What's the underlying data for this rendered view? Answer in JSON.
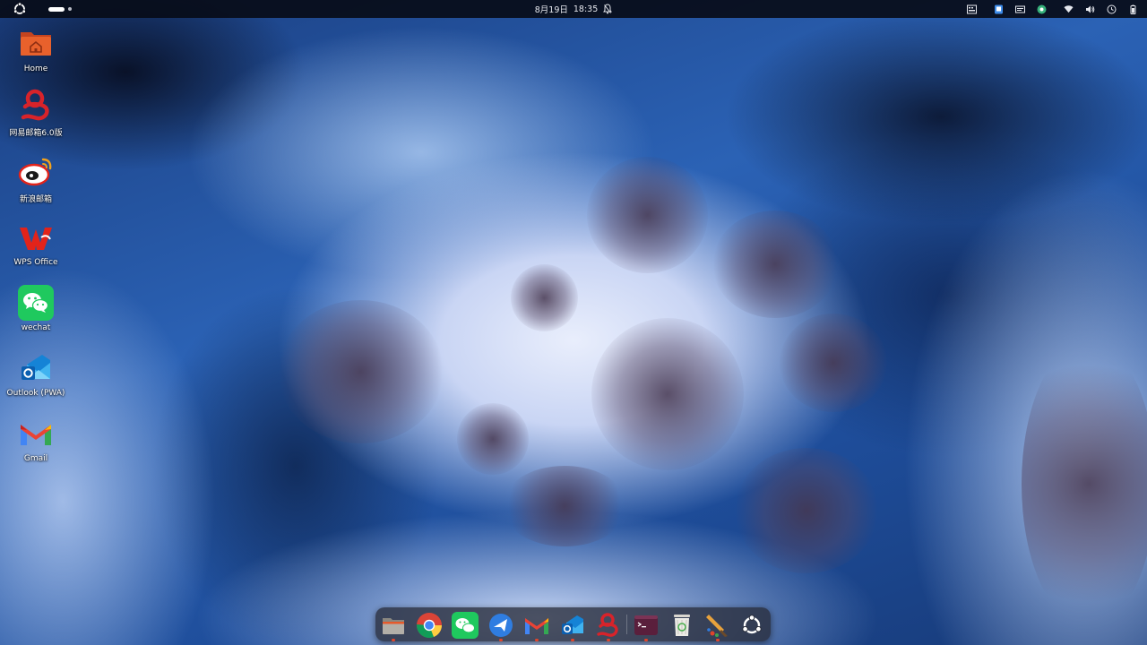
{
  "topbar": {
    "date": "8月19日",
    "time": "18:35",
    "icons": [
      "ubuntu-logo-icon",
      "workspace-indicator",
      "bell-icon",
      "keyboard-layout-icon",
      "app-indicator-icon",
      "input-method-icon",
      "tray-app-icon",
      "wifi-icon",
      "volume-icon",
      "clock-icon",
      "battery-icon"
    ]
  },
  "desktop": {
    "icons": [
      {
        "label": "Home",
        "icon": "home-folder-icon"
      },
      {
        "label": "网易邮箱6.0版",
        "icon": "netease-mail-icon"
      },
      {
        "label": "新浪邮箱",
        "icon": "sina-mail-icon"
      },
      {
        "label": "WPS Office",
        "icon": "wps-office-icon"
      },
      {
        "label": "wechat",
        "icon": "wechat-icon"
      },
      {
        "label": "Outlook (PWA)",
        "icon": "outlook-icon"
      },
      {
        "label": "Gmail",
        "icon": "gmail-icon"
      }
    ]
  },
  "dock": {
    "items": [
      {
        "icon": "files-icon",
        "running": true
      },
      {
        "icon": "chrome-icon",
        "running": false
      },
      {
        "icon": "wechat-icon",
        "running": false
      },
      {
        "icon": "feishu-icon",
        "running": true
      },
      {
        "icon": "gmail-icon",
        "running": true
      },
      {
        "icon": "outlook-icon",
        "running": true
      },
      {
        "icon": "netease-mail-icon",
        "running": true
      },
      {
        "icon": "terminal-icon",
        "running": true
      },
      {
        "icon": "trash-icon",
        "running": false
      },
      {
        "icon": "paint-icon",
        "running": true
      },
      {
        "icon": "app-grid-icon",
        "running": false
      }
    ]
  },
  "colors": {
    "accent": "#e0452b",
    "topbar": "#080c18",
    "dock": "#282c3a"
  }
}
